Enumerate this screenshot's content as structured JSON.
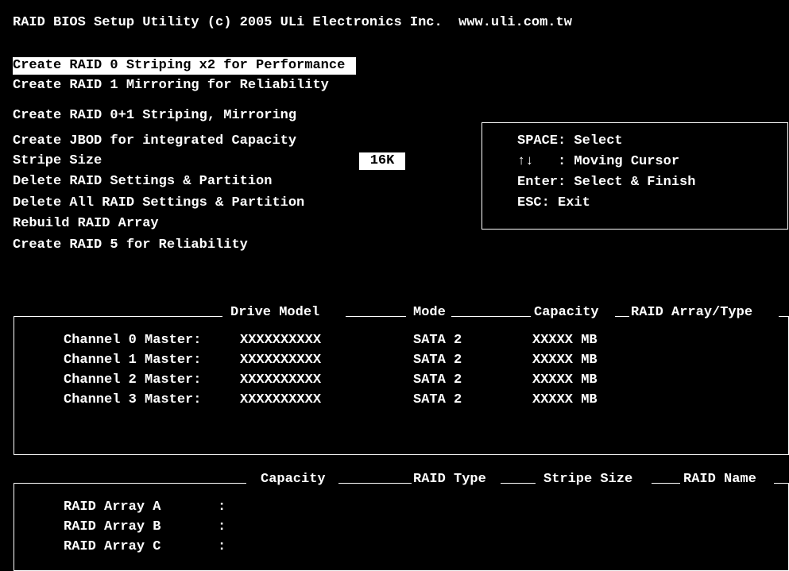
{
  "title": "RAID BIOS Setup Utility (c) 2005 ULi Electronics Inc.  www.uli.com.tw",
  "menu": {
    "items": [
      "Create RAID 0 Striping x2 for Performance",
      "Create RAID 1 Mirroring for Reliability",
      "Create RAID 0+1 Striping, Mirroring",
      "Create JBOD for integrated Capacity",
      "Stripe Size",
      "Delete RAID Settings & Partition",
      "Delete All RAID Settings & Partition",
      "Rebuild RAID Array",
      "Create RAID 5 for Reliability"
    ],
    "selected_index": 0,
    "stripe_size_value": "16K"
  },
  "help": {
    "lines": [
      "SPACE: Select",
      "↑↓   : Moving Cursor",
      "Enter: Select & Finish",
      "ESC: Exit"
    ]
  },
  "drives": {
    "headers": [
      "Drive Model",
      "Mode",
      "Capacity",
      "RAID Array/Type"
    ],
    "rows": [
      {
        "channel": "Channel 0 Master:",
        "model": "XXXXXXXXXX",
        "mode": "SATA 2",
        "capacity": "XXXXX MB",
        "raid": ""
      },
      {
        "channel": "Channel 1 Master:",
        "model": "XXXXXXXXXX",
        "mode": "SATA 2",
        "capacity": "XXXXX MB",
        "raid": ""
      },
      {
        "channel": "Channel 2 Master:",
        "model": "XXXXXXXXXX",
        "mode": "SATA 2",
        "capacity": "XXXXX MB",
        "raid": ""
      },
      {
        "channel": "Channel 3 Master:",
        "model": "XXXXXXXXXX",
        "mode": "SATA 2",
        "capacity": "XXXXX MB",
        "raid": ""
      }
    ]
  },
  "arrays": {
    "headers": [
      "Capacity",
      "RAID Type",
      "Stripe Size",
      "RAID Name"
    ],
    "rows": [
      {
        "name": "RAID Array A",
        "sep": ":"
      },
      {
        "name": "RAID Array B",
        "sep": ":"
      },
      {
        "name": "RAID Array C",
        "sep": ":"
      }
    ]
  }
}
